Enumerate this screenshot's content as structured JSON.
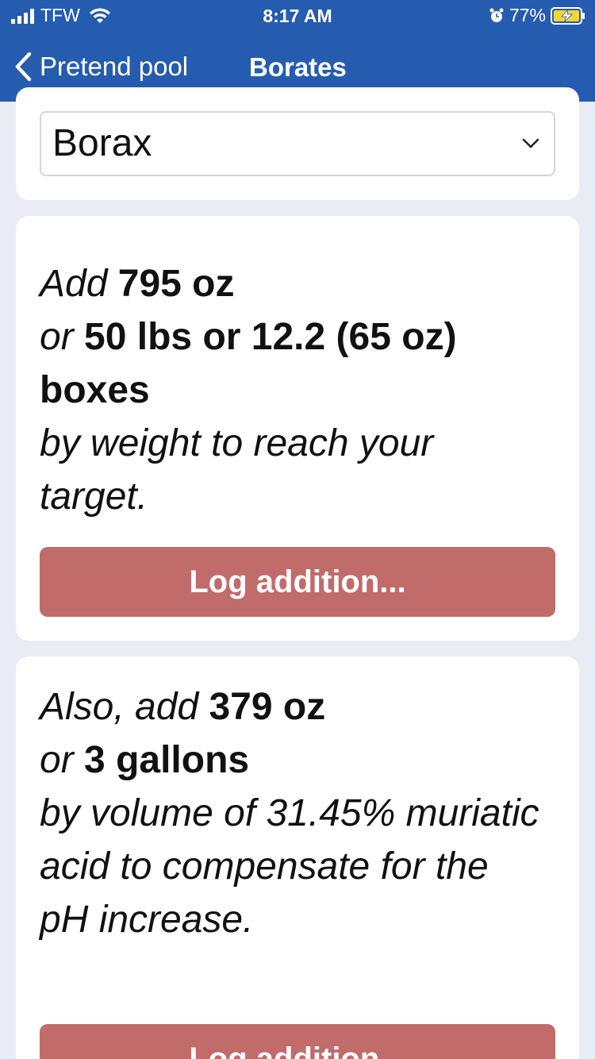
{
  "status_bar": {
    "carrier": "TFW",
    "time": "8:17 AM",
    "battery": "77%"
  },
  "nav": {
    "back_label": "Pretend pool",
    "title": "Borates"
  },
  "chemical_select": {
    "value": "Borax"
  },
  "addition": {
    "prefix": "Add",
    "amount_oz": "795 oz",
    "or1": "or",
    "alt_amount": "50 lbs or 12.2 (65 oz) boxes",
    "suffix": "by weight to reach your target.",
    "button_label": "Log addition..."
  },
  "compensation": {
    "prefix": "Also, add",
    "amount_oz": "379 oz",
    "or1": "or",
    "alt_amount": "3 gallons",
    "suffix": "by volume of 31.45% muriatic acid to compensate for the pH increase.",
    "button_label": "Log addition..."
  },
  "colors": {
    "header": "#255cb0",
    "background": "#e9ecf5",
    "button": "#c16b6b"
  }
}
